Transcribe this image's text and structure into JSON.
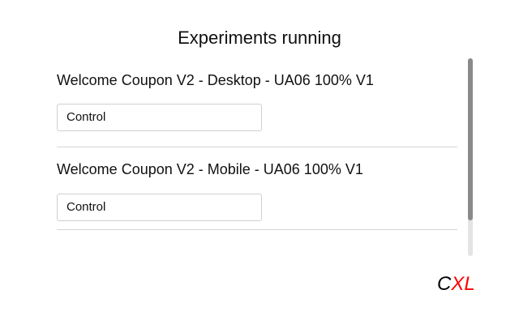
{
  "header": {
    "title": "Experiments running"
  },
  "experiments": [
    {
      "name": "Welcome Coupon V2 - Desktop - UA06 100% V1",
      "selected_variant": "Control"
    },
    {
      "name": "Welcome Coupon V2 - Mobile - UA06 100% V1",
      "selected_variant": "Control"
    }
  ],
  "logo": {
    "part1": "C",
    "part2": "XL",
    "color_part1": "#000000",
    "color_part2": "#ff0000"
  }
}
